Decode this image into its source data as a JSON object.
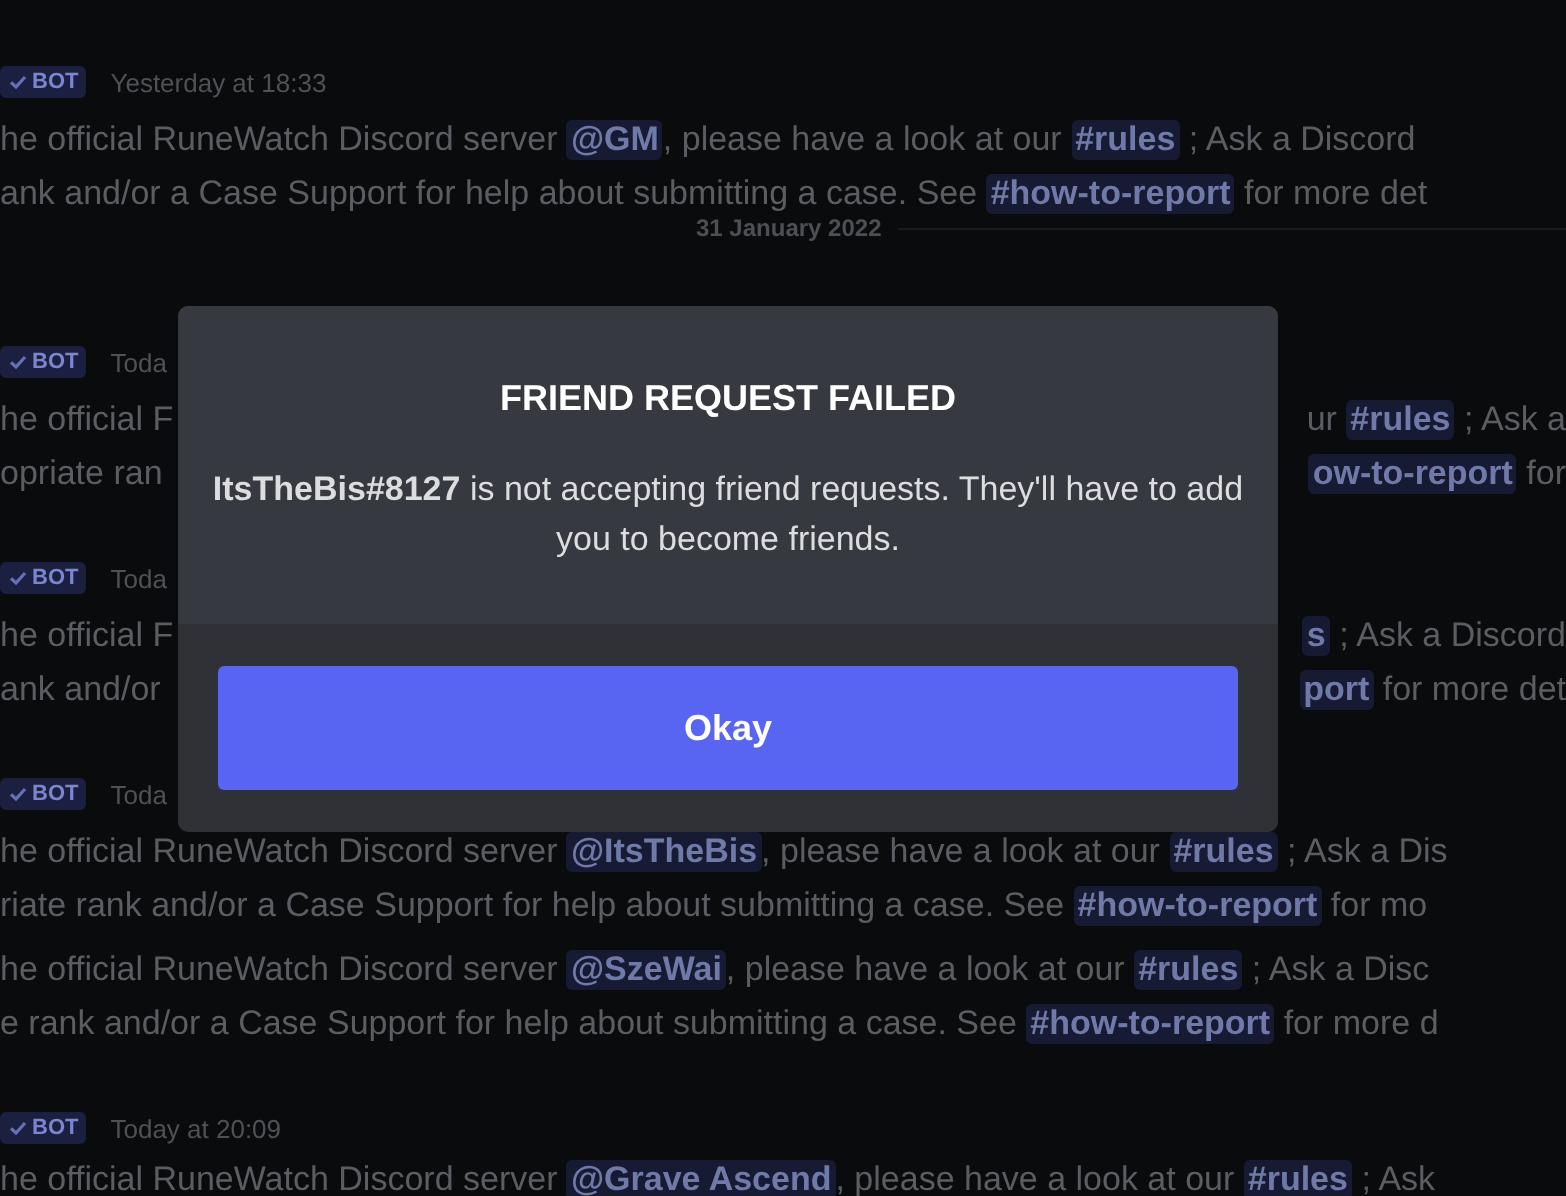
{
  "chat": {
    "messages": [
      {
        "badge": "BOT",
        "timestamp": "Yesterday at 18:33",
        "lines": [
          {
            "left": [
              {
                "kind": "text",
                "text": "he official RuneWatch Discord server "
              },
              {
                "kind": "mention",
                "text": "@GM"
              },
              {
                "kind": "text",
                "text": ", please have a look at our "
              },
              {
                "kind": "channel",
                "text": "#rules"
              },
              {
                "kind": "text",
                "text": " ; Ask a Discord"
              }
            ]
          },
          {
            "left": [
              {
                "kind": "text",
                "text": "ank and/or a Case Support for help about submitting a case. See "
              },
              {
                "kind": "channel",
                "text": "#how-to-report"
              },
              {
                "kind": "text",
                "text": " for more det"
              }
            ]
          }
        ]
      },
      {
        "divider": "31 January 2022"
      },
      {
        "badge": "BOT",
        "timestamp": "Toda",
        "lines": [
          {
            "left": [
              {
                "kind": "text",
                "text": "he official F"
              }
            ],
            "right": [
              {
                "kind": "text",
                "text": "ur "
              },
              {
                "kind": "channel",
                "text": "#rules"
              },
              {
                "kind": "text",
                "text": " ; Ask a"
              }
            ]
          },
          {
            "left": [
              {
                "kind": "text",
                "text": "opriate ran"
              }
            ],
            "right": [
              {
                "kind": "channel",
                "text": "ow-to-report"
              },
              {
                "kind": "text",
                "text": " for"
              }
            ]
          }
        ]
      },
      {
        "badge": "BOT",
        "timestamp": "Toda",
        "lines": [
          {
            "left": [
              {
                "kind": "text",
                "text": "he official F"
              }
            ],
            "right": [
              {
                "kind": "channel",
                "text": "s"
              },
              {
                "kind": "text",
                "text": " ; Ask a Discord"
              }
            ]
          },
          {
            "left": [
              {
                "kind": "text",
                "text": "ank and/or"
              }
            ],
            "right": [
              {
                "kind": "channel",
                "text": "port"
              },
              {
                "kind": "text",
                "text": " for more det"
              }
            ]
          }
        ]
      },
      {
        "badge": "BOT",
        "timestamp": "Toda",
        "lines": [
          {
            "left": [
              {
                "kind": "text",
                "text": "he official RuneWatch Discord server "
              },
              {
                "kind": "mention",
                "text": "@ItsTheBis"
              },
              {
                "kind": "text",
                "text": ", please have a look at our "
              },
              {
                "kind": "channel",
                "text": "#rules"
              },
              {
                "kind": "text",
                "text": " ; Ask a Dis"
              }
            ]
          },
          {
            "left": [
              {
                "kind": "text",
                "text": "riate rank and/or a Case Support for help about submitting a case. See "
              },
              {
                "kind": "channel",
                "text": "#how-to-report"
              },
              {
                "kind": "text",
                "text": " for mo"
              }
            ]
          }
        ]
      },
      {
        "lines": [
          {
            "left": [
              {
                "kind": "text",
                "text": "he official RuneWatch Discord server "
              },
              {
                "kind": "mention",
                "text": "@SzeWai"
              },
              {
                "kind": "text",
                "text": ", please have a look at our "
              },
              {
                "kind": "channel",
                "text": "#rules"
              },
              {
                "kind": "text",
                "text": " ; Ask a Disc"
              }
            ]
          },
          {
            "left": [
              {
                "kind": "text",
                "text": "e rank and/or a Case Support for help about submitting a case. See "
              },
              {
                "kind": "channel",
                "text": "#how-to-report"
              },
              {
                "kind": "text",
                "text": " for more d"
              }
            ]
          }
        ]
      },
      {
        "badge": "BOT",
        "timestamp": "Today at 20:09",
        "lines": [
          {
            "left": [
              {
                "kind": "text",
                "text": "he official RuneWatch Discord server "
              },
              {
                "kind": "mention",
                "text": "@Grave Ascend"
              },
              {
                "kind": "text",
                "text": ", please have a look at our "
              },
              {
                "kind": "channel",
                "text": "#rules"
              },
              {
                "kind": "text",
                "text": " ; Ask"
              }
            ]
          }
        ]
      }
    ]
  },
  "dialog": {
    "title": "FRIEND REQUEST FAILED",
    "message": "**ItsTheBis#8127** is not accepting friend requests. They'll have to add you to become friends.",
    "button": "Okay"
  }
}
